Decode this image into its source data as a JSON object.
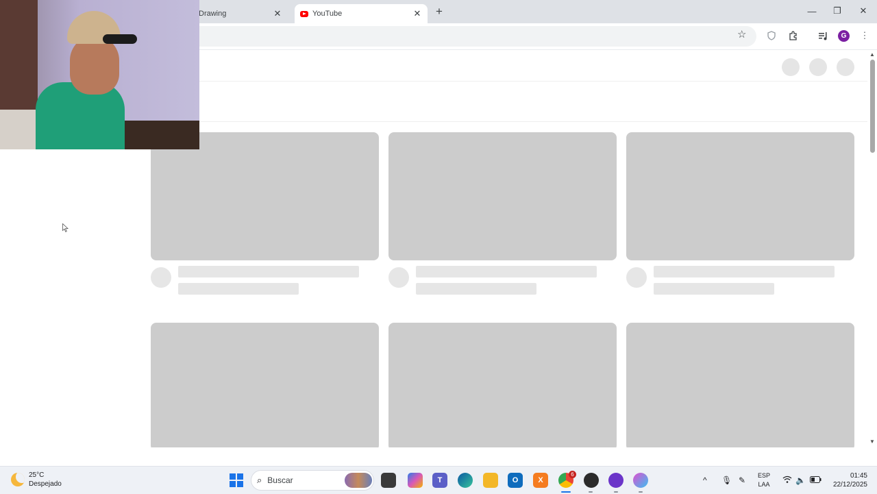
{
  "browser": {
    "tabs": [
      {
        "title": "Drawing",
        "active": false
      },
      {
        "title": "YouTube",
        "active": true
      }
    ],
    "new_tab_symbol": "+",
    "close_symbol": "✕",
    "window_controls": {
      "minimize": "—",
      "restore": "❐",
      "close": "✕"
    },
    "profile_initial": "G",
    "icons": [
      "bookmark-star-icon",
      "extension-shield-icon",
      "extensions-puzzle-icon",
      "media-controls-icon",
      "profile-avatar",
      "menu-kebab-icon"
    ]
  },
  "page": {
    "state": "loading-skeleton",
    "skeleton_rows": 2,
    "skeleton_columns": 3,
    "colors": {
      "thumbnail": "#cccccc",
      "placeholder": "#e6e6e6"
    }
  },
  "taskbar": {
    "weather": {
      "temp": "25°C",
      "condition": "Despejado"
    },
    "search_placeholder": "Buscar",
    "language": {
      "line1": "ESP",
      "line2": "LAA"
    },
    "clock": {
      "time": "01:45",
      "date": "22/12/2025"
    },
    "chrome_badge": "6",
    "apps": [
      "windows-start",
      "search",
      "file-explorer-dark",
      "copilot",
      "teams",
      "edge",
      "file-explorer",
      "outlook",
      "xampp",
      "chrome",
      "obs",
      "podcast-app",
      "browser-app"
    ]
  }
}
